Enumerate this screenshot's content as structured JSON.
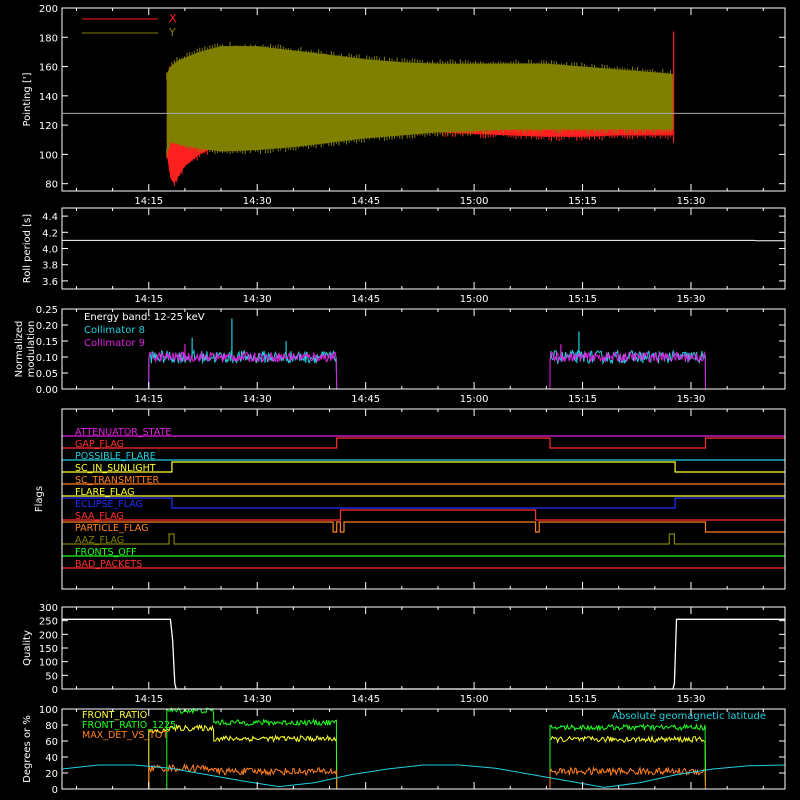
{
  "x_axis": {
    "ticks": [
      "14:15",
      "14:30",
      "14:45",
      "15:00",
      "15:15",
      "15:30"
    ],
    "tick_minutes": [
      855,
      870,
      885,
      900,
      915,
      930
    ],
    "range_minutes": [
      843,
      943
    ]
  },
  "colors": {
    "background": "#000000",
    "axes": "#ffffff",
    "pointing_x": "#ff2020",
    "pointing_y": "#808000",
    "collimator_8": "#20d0e0",
    "collimator_9": "#e020e0",
    "front_ratio": "#ffff30",
    "front_ratio_1225": "#20ff20",
    "max_det_vs_tot": "#ff8020",
    "geomag_lat": "#20d0e0"
  },
  "chart_data": [
    {
      "panel": "pointing",
      "type": "area",
      "ylabel": "Pointing [']",
      "ylim": [
        75,
        200
      ],
      "yticks": [
        80,
        100,
        120,
        140,
        160,
        180,
        200
      ],
      "reference_line": 128,
      "legend": [
        "X",
        "Y"
      ],
      "series": [
        {
          "name": "X",
          "x": [
            857.5,
            858,
            858.5,
            859,
            860,
            862,
            865,
            870,
            875,
            880,
            885,
            890,
            895,
            900,
            905,
            910,
            915,
            920,
            925,
            927.5
          ],
          "upper": [
            155,
            158,
            160,
            160,
            159,
            158,
            157,
            155,
            154,
            153,
            152,
            152,
            152,
            153,
            153,
            153,
            152,
            151,
            151,
            152
          ],
          "lower": [
            100,
            84,
            80,
            84,
            92,
            100,
            107,
            113,
            116,
            117,
            117,
            116,
            115,
            114,
            113,
            112,
            112,
            113,
            113,
            113
          ]
        },
        {
          "name": "Y",
          "x": [
            857.5,
            858,
            858.5,
            859,
            860,
            862,
            865,
            870,
            875,
            880,
            885,
            890,
            895,
            900,
            905,
            910,
            915,
            920,
            925,
            927.5
          ],
          "upper": [
            155,
            160,
            162,
            164,
            166,
            170,
            174,
            174,
            171,
            168,
            165,
            163,
            162,
            162,
            162,
            162,
            160,
            158,
            156,
            155
          ],
          "lower": [
            100,
            108,
            108,
            107,
            106,
            104,
            102,
            103,
            105,
            108,
            111,
            113,
            115,
            116,
            117,
            117,
            117,
            117,
            117,
            117
          ]
        }
      ]
    },
    {
      "panel": "roll",
      "type": "line",
      "ylabel": "Roll period [s]",
      "ylim": [
        3.5,
        4.5
      ],
      "yticks": [
        "3.6",
        "3.8",
        "4.0",
        "4.2",
        "4.4"
      ],
      "series": [
        {
          "name": "",
          "x": [
            843,
            938.8,
            939,
            943
          ],
          "values": [
            4.1,
            4.1,
            4.095,
            4.095
          ]
        }
      ]
    },
    {
      "panel": "modulation",
      "type": "line",
      "ylabel": "Normalized modulation",
      "ylim": [
        0,
        0.25
      ],
      "yticks": [
        "0.00",
        "0.05",
        "0.10",
        "0.15",
        "0.20",
        "0.25"
      ],
      "annotation": "Energy band: 12-25 keV",
      "series": [
        {
          "name": "Collimator 8",
          "segments": [
            [
              855,
              881
            ],
            [
              910.5,
              932
            ]
          ],
          "mean": 0.1,
          "spread": 0.02,
          "spikes": [
            [
              866.5,
              0.22
            ],
            [
              861,
              0.16
            ],
            [
              874,
              0.15
            ],
            [
              914.5,
              0.18
            ]
          ]
        },
        {
          "name": "Collimator 9",
          "segments": [
            [
              855,
              881
            ],
            [
              910.5,
              932
            ]
          ],
          "mean": 0.1,
          "spread": 0.015,
          "spikes": [
            [
              860,
              0.14
            ],
            [
              912,
              0.14
            ]
          ]
        }
      ]
    },
    {
      "panel": "flags",
      "type": "line",
      "ylabel": "Flags",
      "rows": [
        {
          "name": "ATTENUATOR_STATE",
          "color": "#e020e0",
          "transitions": []
        },
        {
          "name": "GAP_FLAG",
          "color": "#ff3030",
          "transitions": [
            [
              881,
              1
            ],
            [
              910.5,
              0
            ],
            [
              932,
              1
            ]
          ]
        },
        {
          "name": "POSSIBLE_FLARE",
          "color": "#20d0e0",
          "transitions": []
        },
        {
          "name": "SC_IN_SUNLIGHT",
          "color": "#ffff30",
          "transitions": [
            [
              858.2,
              1
            ],
            [
              927.8,
              0
            ]
          ]
        },
        {
          "name": "SC_TRANSMITTER",
          "color": "#ff8020",
          "transitions": []
        },
        {
          "name": "FLARE_FLAG",
          "color": "#ffff30",
          "transitions": []
        },
        {
          "name": "ECLIPSE_FLAG",
          "color": "#2030ff",
          "transitions": [
            [
              858.2,
              0
            ],
            [
              927.8,
              1
            ]
          ]
        },
        {
          "name": "SAA_FLAG",
          "color": "#ff3030",
          "transitions": [
            [
              881.5,
              1
            ],
            [
              908.5,
              0
            ]
          ]
        },
        {
          "name": "PARTICLE_FLAG",
          "color": "#ff8020",
          "transitions": [
            [
              880.5,
              0
            ],
            [
              881,
              1
            ],
            [
              881.5,
              0
            ],
            [
              882,
              1
            ],
            [
              908.5,
              0
            ],
            [
              909,
              1
            ],
            [
              932,
              0
            ]
          ]
        },
        {
          "name": "AAZ_FLAG",
          "color": "#808000",
          "transitions": [
            [
              857.8,
              1
            ],
            [
              858.5,
              0
            ],
            [
              927,
              1
            ],
            [
              927.7,
              0
            ]
          ]
        },
        {
          "name": "FRONTS_OFF",
          "color": "#20ff20",
          "transitions": []
        },
        {
          "name": "BAD_PACKETS",
          "color": "#ff3030",
          "transitions": []
        }
      ]
    },
    {
      "panel": "quality",
      "type": "line",
      "ylabel": "Quality",
      "ylim": [
        0,
        300
      ],
      "yticks": [
        0,
        50,
        100,
        150,
        200,
        250,
        300
      ],
      "series": [
        {
          "name": "",
          "x": [
            843,
            858,
            858.3,
            858.6,
            858.8,
            927.5,
            927.7,
            928,
            943
          ],
          "values": [
            255,
            255,
            180,
            20,
            0,
            0,
            20,
            255,
            255
          ]
        }
      ]
    },
    {
      "panel": "ratios",
      "type": "line",
      "ylabel": "Degrees or %",
      "ylim": [
        0,
        100
      ],
      "yticks": [
        0,
        20,
        40,
        60,
        80,
        100
      ],
      "legend": [
        "FRONT_RATIO",
        "FRONT_RATIO_1225",
        "MAX_DET_VS_TOT"
      ],
      "annotation": "Absolute geomagnetic latitude",
      "series": [
        {
          "name": "FRONT_RATIO",
          "segments": [
            [
              855,
              857.5,
              72
            ],
            [
              857.5,
              864,
              76
            ],
            [
              864,
              881,
              63
            ],
            [
              910.5,
              932,
              62
            ]
          ]
        },
        {
          "name": "FRONT_RATIO_1225",
          "segments": [
            [
              857.5,
              864,
              98
            ],
            [
              864,
              881,
              83
            ],
            [
              910.5,
              932,
              77
            ]
          ]
        },
        {
          "name": "MAX_DET_VS_TOT",
          "segments": [
            [
              855,
              864,
              26
            ],
            [
              864,
              881,
              22
            ],
            [
              910.5,
              932,
              22
            ]
          ]
        },
        {
          "name": "Absolute geomagnetic latitude",
          "x": [
            843,
            848,
            853,
            858,
            863,
            868,
            873,
            878,
            883,
            888,
            893,
            898,
            903,
            908,
            913,
            918,
            923,
            928,
            933,
            938,
            943
          ],
          "values": [
            25,
            30,
            30,
            26,
            18,
            10,
            3,
            8,
            18,
            25,
            30,
            30,
            26,
            18,
            10,
            2,
            8,
            18,
            25,
            29,
            30
          ]
        }
      ]
    }
  ]
}
